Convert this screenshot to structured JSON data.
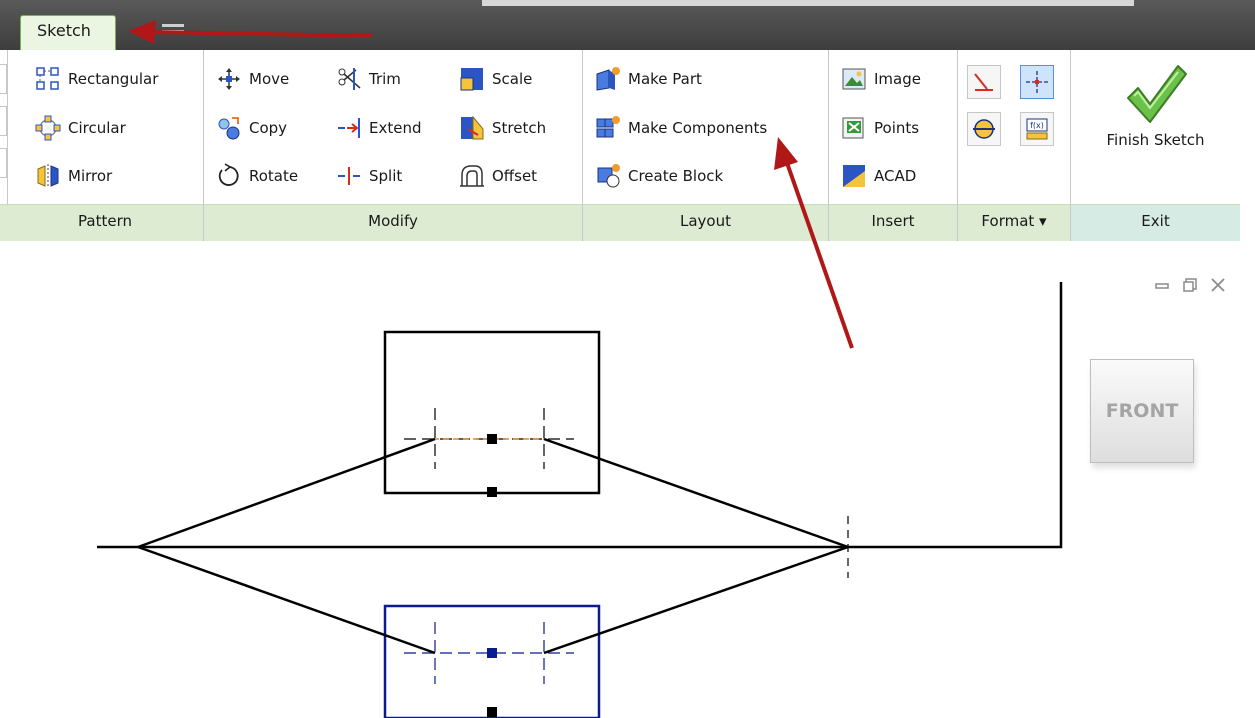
{
  "ribbon_tab": {
    "label": "Sketch"
  },
  "panels": {
    "pattern": {
      "title": "Pattern",
      "buttons": [
        "Rectangular",
        "Circular",
        "Mirror"
      ]
    },
    "modify": {
      "title": "Modify",
      "col1": [
        "Move",
        "Copy",
        "Rotate"
      ],
      "col2": [
        "Trim",
        "Extend",
        "Split"
      ],
      "col3": [
        "Scale",
        "Stretch",
        "Offset"
      ]
    },
    "layout": {
      "title": "Layout",
      "buttons": [
        "Make Part",
        "Make Components",
        "Create Block"
      ]
    },
    "insert": {
      "title": "Insert",
      "buttons": [
        "Image",
        "Points",
        "ACAD"
      ]
    },
    "format": {
      "title": "Format ▾"
    },
    "exit": {
      "title": "Exit",
      "finish_label": "Finish Sketch"
    }
  },
  "viewcube": {
    "face_label": "FRONT"
  },
  "icons": {
    "tab_menu": "menu-icon",
    "finish": "checkmark-icon",
    "window_controls": [
      "minimize-icon",
      "restore-icon",
      "close-icon"
    ]
  },
  "colors": {
    "accent_green": "#dcebd2",
    "annotation_arrow": "#b01818",
    "sketch_line": "#000000",
    "selected_geometry": "#0b1a8c",
    "constraint_orange": "#e08a2a"
  }
}
